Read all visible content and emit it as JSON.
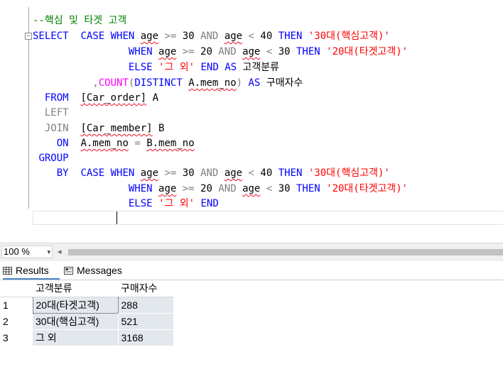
{
  "editor": {
    "comment": "--핵심 및 타겟 고객",
    "collapse_glyph": "−",
    "kw": {
      "select": "SELECT",
      "case": "CASE",
      "when": "WHEN",
      "then": "THEN",
      "else": "ELSE",
      "end": "END",
      "as": "AS",
      "and": "AND",
      "count": "COUNT",
      "distinct": "DISTINCT",
      "from": "FROM",
      "left": "LEFT",
      "join": "JOIN",
      "on": "ON",
      "group": "GROUP",
      "by": "BY"
    },
    "ops": {
      "ge": ">=",
      "lt": "<",
      "eq": "=",
      "comma": ",",
      "lparen": "(",
      "rparen": ")"
    },
    "ident": {
      "age": "age",
      "n30": "30",
      "n40": "40",
      "n20": "20",
      "alias_segment": "고객분류",
      "alias_count": "구매자수",
      "mem_no_a": "A.mem_no",
      "mem_no_b": "B.mem_no",
      "table_order": "[Car_order]",
      "alias_a": "A",
      "table_member": "[Car_member]",
      "alias_b": "B"
    },
    "str": {
      "core": "'30대(핵심고객)'",
      "target": "'20대(타겟고객)'",
      "other": "'그 외'"
    }
  },
  "status": {
    "zoom": "100 %",
    "zoom_caret": "▾",
    "scroll_left": "◂"
  },
  "tabs": {
    "results": "Results",
    "messages": "Messages"
  },
  "grid": {
    "headers": [
      "고객분류",
      "구매자수"
    ],
    "rows": [
      {
        "num": "1",
        "segment": "20대(타겟고객)",
        "buyers": "288"
      },
      {
        "num": "2",
        "segment": "30대(핵심고객)",
        "buyers": "521"
      },
      {
        "num": "3",
        "segment": "그 외",
        "buyers": "3168"
      }
    ]
  }
}
